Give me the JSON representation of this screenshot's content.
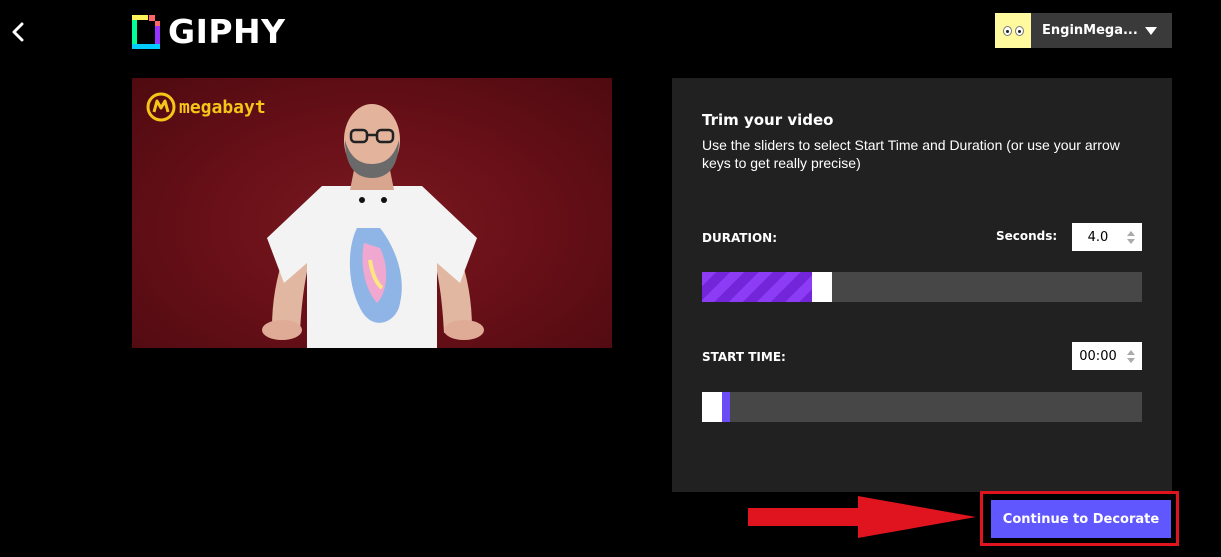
{
  "header": {
    "back_icon": "chevron-left-icon",
    "logo_text": "GIPHY",
    "user": {
      "name": "EnginMega..."
    }
  },
  "video": {
    "brand_text": "megabayt"
  },
  "trim": {
    "title": "Trim your video",
    "description": "Use the sliders to select Start Time and Duration (or use your arrow keys to get really precise)",
    "duration": {
      "label": "DURATION:",
      "seconds_label": "Seconds:",
      "value": "4.0"
    },
    "start": {
      "label": "START TIME:",
      "value": "00:00"
    }
  },
  "cta": {
    "label": "Continue to Decorate"
  },
  "colors": {
    "accent": "#6157ff",
    "duration_fill_a": "#8c3cf5",
    "duration_fill_b": "#7225d9",
    "start_fill": "#6b4cf5",
    "panel_bg": "#212121",
    "track_bg": "#474747",
    "highlight": "#e0141e"
  }
}
